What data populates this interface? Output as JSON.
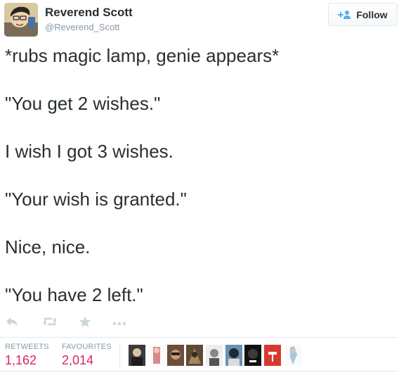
{
  "author": {
    "name": "Reverend Scott",
    "handle": "@Reverend_Scott"
  },
  "follow_button": {
    "label": "Follow",
    "icon": "add-user-icon"
  },
  "tweet_lines": [
    "*rubs magic lamp, genie appears*",
    "\"You get 2 wishes.\"",
    "I wish I got 3 wishes.",
    "\"Your wish is granted.\"",
    "Nice, nice.",
    "\"You have 2 left.\""
  ],
  "actions": [
    {
      "name": "reply-icon"
    },
    {
      "name": "retweet-icon"
    },
    {
      "name": "favorite-star-icon"
    },
    {
      "name": "more-dots-icon"
    }
  ],
  "stats": {
    "retweets": {
      "label": "RETWEETS",
      "value": "1,162"
    },
    "favourites": {
      "label": "FAVOURITES",
      "value": "2,014"
    }
  },
  "colors": {
    "text": "#292f33",
    "muted": "#8899a6",
    "stat_value": "#e0245e",
    "border": "#e1e8ed"
  }
}
